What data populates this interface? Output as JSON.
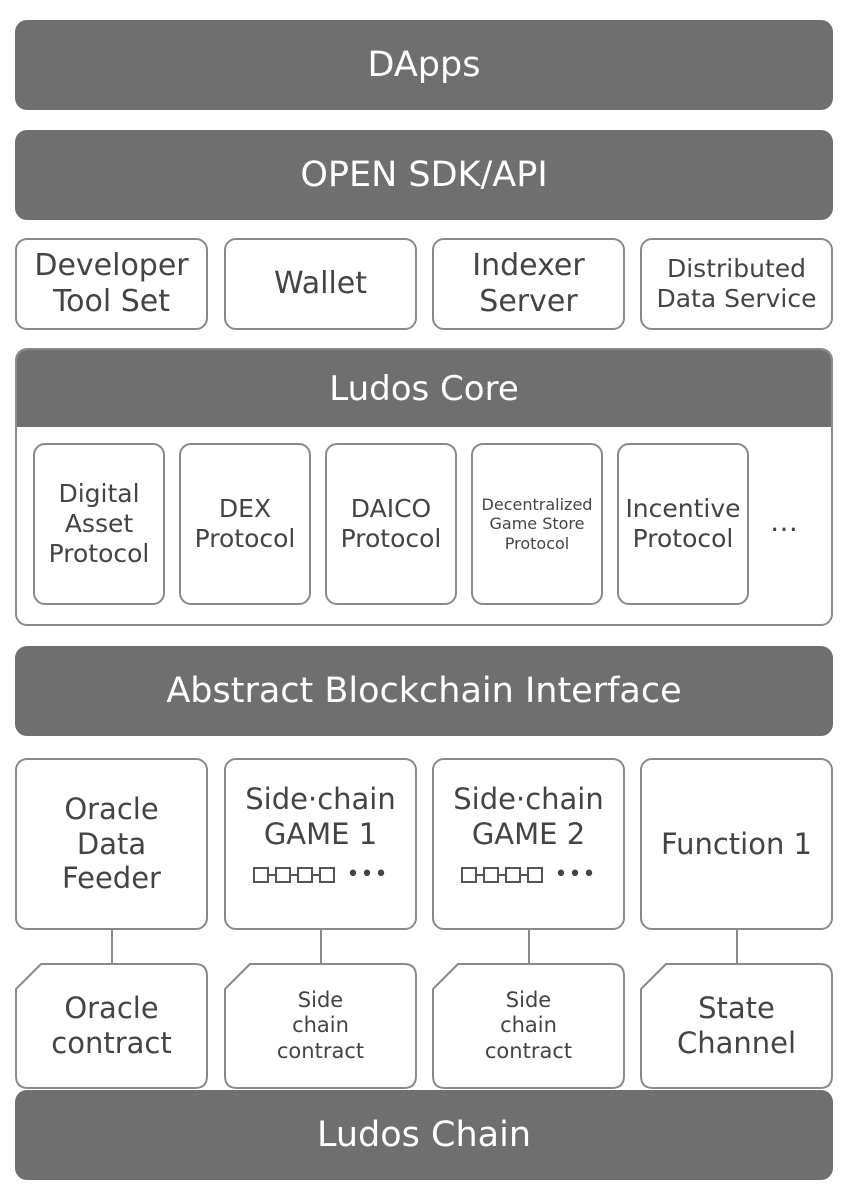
{
  "layers": {
    "dapps": "DApps",
    "sdk": "OPEN SDK/API",
    "tools": [
      [
        "Developer",
        "Tool Set"
      ],
      [
        "Wallet"
      ],
      [
        "Indexer",
        "Server"
      ],
      [
        "Distributed",
        "Data Service"
      ]
    ],
    "core": {
      "title": "Ludos Core",
      "protocols": [
        [
          "Digital",
          "Asset",
          "Protocol"
        ],
        [
          "DEX",
          "Protocol"
        ],
        [
          "DAICO",
          "Protocol"
        ],
        [
          "Decentralized",
          "Game Store",
          "Protocol"
        ],
        [
          "Incentive",
          "Protocol"
        ]
      ],
      "more": "…"
    },
    "abi": "Abstract Blockchain Interface",
    "modules": [
      [
        "Oracle",
        "Data",
        "Feeder"
      ],
      [
        "Side·chain",
        "GAME 1"
      ],
      [
        "Side·chain",
        "GAME 2"
      ],
      [
        "Function 1"
      ]
    ],
    "chain_more": "•••",
    "contracts": [
      [
        "Oracle",
        "contract"
      ],
      [
        "Side",
        "chain",
        "contract"
      ],
      [
        "Side",
        "chain",
        "contract"
      ],
      [
        "State",
        "Channel"
      ]
    ],
    "base": "Ludos Chain"
  },
  "colors": {
    "bar": "#6f6f6f",
    "border": "#8a8a8a",
    "text": "#444444"
  }
}
